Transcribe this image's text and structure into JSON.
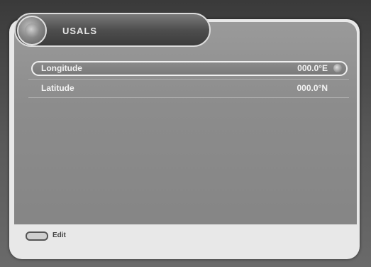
{
  "title": "USALS",
  "rows": [
    {
      "label": "Longitude",
      "value": "000.0°E"
    },
    {
      "label": "Latitude",
      "value": "000.0°N"
    }
  ],
  "footer": {
    "hint": "Edit"
  },
  "icons": {
    "title": "satellite-dish-icon",
    "selector": "knob-icon",
    "footer": "ok-key-icon"
  }
}
